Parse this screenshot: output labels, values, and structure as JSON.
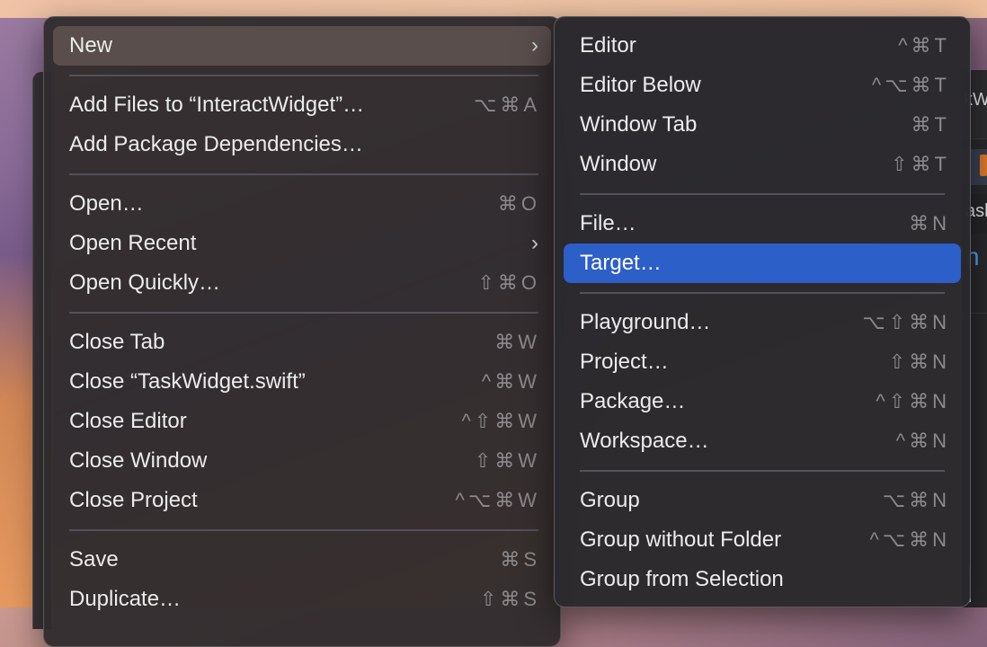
{
  "background_window": {
    "title_fragment": "kW",
    "row_fragment": "ask",
    "big_fragment": "n"
  },
  "menu": {
    "items": [
      {
        "label": "New",
        "shortcut": "",
        "submenu": true
      },
      {
        "label": "Add Files to “InteractWidget”…",
        "shortcut": "⌥⌘A"
      },
      {
        "label": "Add Package Dependencies…",
        "shortcut": ""
      },
      {
        "label": "Open…",
        "shortcut": "⌘O"
      },
      {
        "label": "Open Recent",
        "shortcut": "",
        "submenu": true
      },
      {
        "label": "Open Quickly…",
        "shortcut": "⇧⌘O"
      },
      {
        "label": "Close Tab",
        "shortcut": "⌘W"
      },
      {
        "label": "Close “TaskWidget.swift”",
        "shortcut": "^⌘W"
      },
      {
        "label": "Close Editor",
        "shortcut": "^⇧⌘W"
      },
      {
        "label": "Close Window",
        "shortcut": "⇧⌘W"
      },
      {
        "label": "Close Project",
        "shortcut": "^⌥⌘W"
      },
      {
        "label": "Save",
        "shortcut": "⌘S"
      },
      {
        "label": "Duplicate…",
        "shortcut": "⇧⌘S"
      }
    ],
    "chevron": "›"
  },
  "submenu": {
    "items": [
      {
        "label": "Editor",
        "shortcut": "^⌘T"
      },
      {
        "label": "Editor Below",
        "shortcut": "^⌥⌘T"
      },
      {
        "label": "Window Tab",
        "shortcut": "⌘T"
      },
      {
        "label": "Window",
        "shortcut": "⇧⌘T"
      },
      {
        "label": "File…",
        "shortcut": "⌘N"
      },
      {
        "label": "Target…",
        "shortcut": "",
        "selected": true
      },
      {
        "label": "Playground…",
        "shortcut": "⌥⇧⌘N"
      },
      {
        "label": "Project…",
        "shortcut": "⇧⌘N"
      },
      {
        "label": "Package…",
        "shortcut": "^⇧⌘N"
      },
      {
        "label": "Workspace…",
        "shortcut": "^⌘N"
      },
      {
        "label": "Group",
        "shortcut": "⌥⌘N"
      },
      {
        "label": "Group without Folder",
        "shortcut": "^⌥⌘N"
      },
      {
        "label": "Group from Selection",
        "shortcut": ""
      }
    ]
  },
  "colors": {
    "selection": "#2d5fc8",
    "menu_bg": "#302c2e",
    "shortcut": "#8d8a8e"
  }
}
